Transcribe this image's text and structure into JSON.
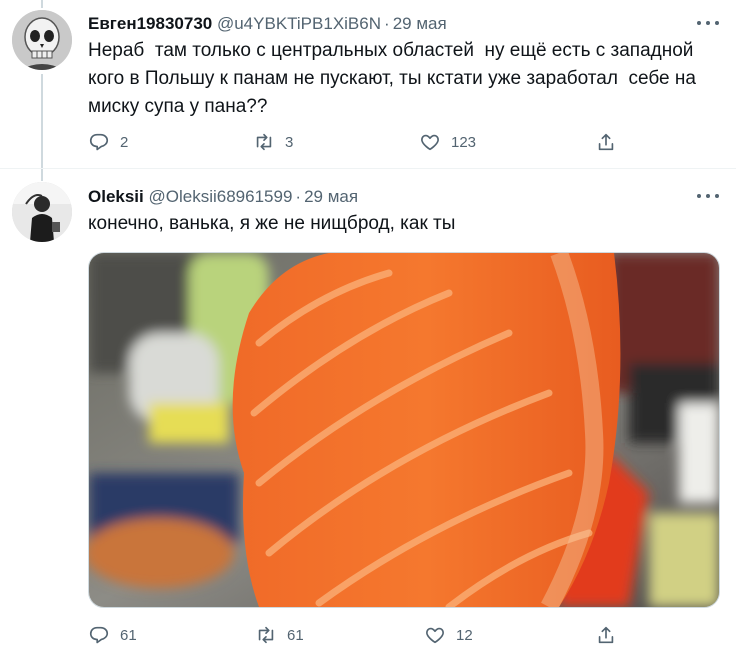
{
  "tweets": [
    {
      "author_name": "Евген19830730",
      "handle": "@u4YBKTiPB1XiB6N",
      "separator": "·",
      "date": "29 мая",
      "text": "Нераб  там только с центральных областей  ну ещё есть с западной кого в Польшу к панам не пускают, ты кстати уже заработал  себе на миску супа у пана??",
      "replies": "2",
      "retweets": "3",
      "likes": "123"
    },
    {
      "author_name": "Oleksii",
      "handle": "@Oleksii68961599",
      "separator": "·",
      "date": "29 мая",
      "text": "конечно, ванька, я же не нищброд, как ты",
      "replies": "61",
      "retweets": "61",
      "likes": "12"
    }
  ],
  "icons": {
    "reply": "reply-icon",
    "retweet": "retweet-icon",
    "like": "heart-icon",
    "share": "share-icon",
    "more": "more-icon"
  },
  "colors": {
    "text": "#0f1419",
    "secondary": "#536471",
    "divider": "#eff3f4",
    "thread_line": "#cfd9de"
  }
}
